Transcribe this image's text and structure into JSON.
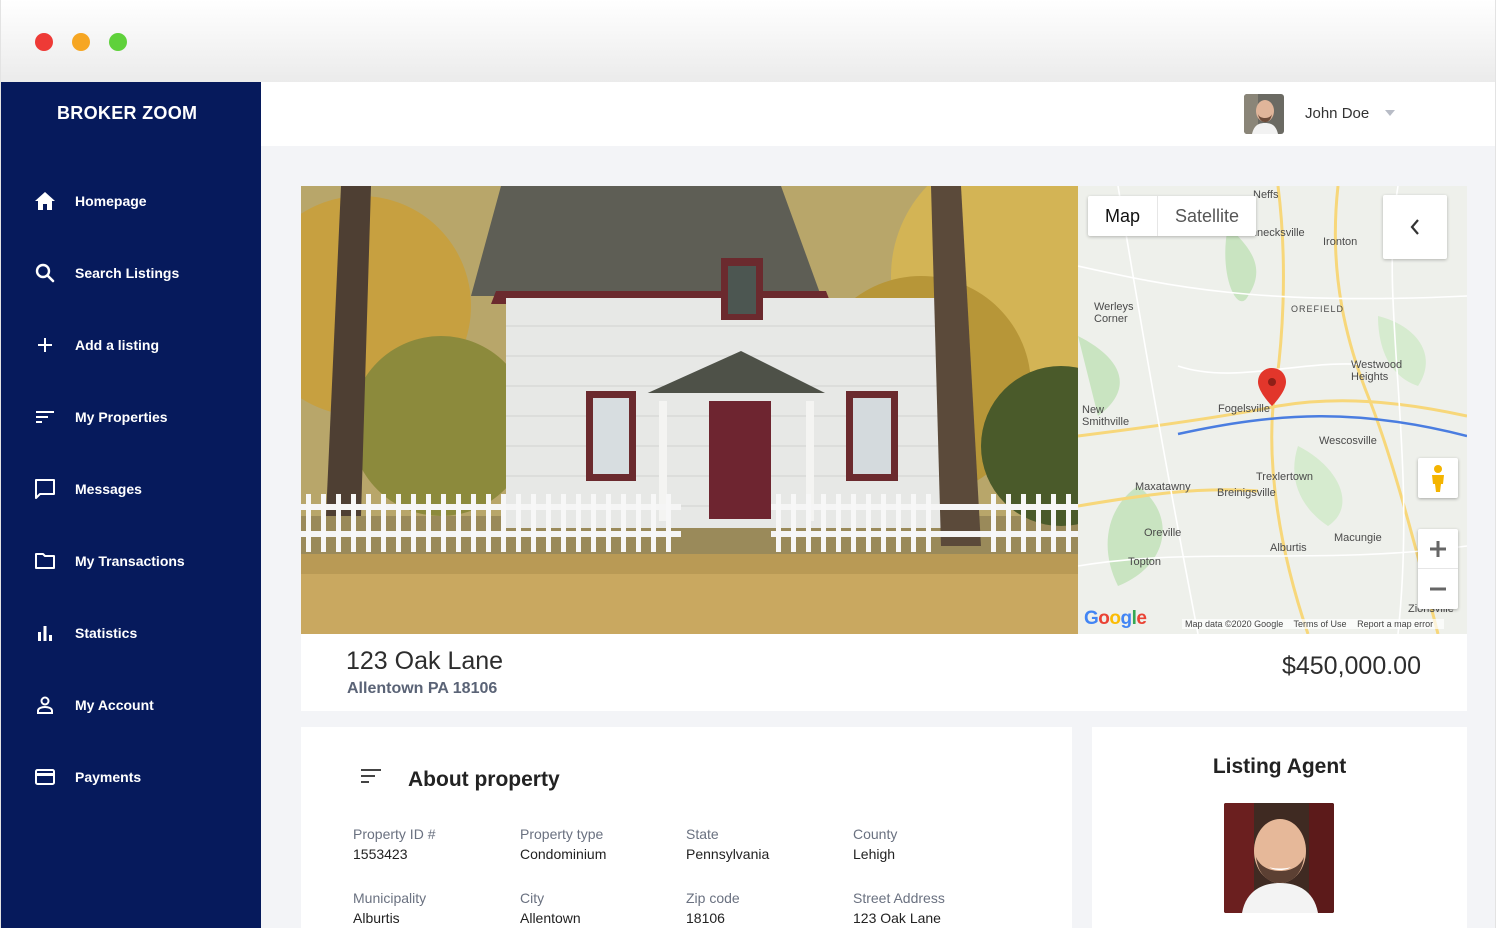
{
  "brand": {
    "logo_text": "BROKER ZOOM"
  },
  "sidebar": {
    "items": [
      {
        "label": "Homepage",
        "icon": "home-icon"
      },
      {
        "label": "Search Listings",
        "icon": "search-icon"
      },
      {
        "label": "Add a listing",
        "icon": "plus-icon"
      },
      {
        "label": "My Properties",
        "icon": "sort-lines-icon"
      },
      {
        "label": "Messages",
        "icon": "message-icon"
      },
      {
        "label": "My Transactions",
        "icon": "folder-icon"
      },
      {
        "label": "Statistics",
        "icon": "bar-chart-icon"
      },
      {
        "label": "My Account",
        "icon": "person-icon"
      },
      {
        "label": "Payments",
        "icon": "credit-card-icon"
      }
    ]
  },
  "user": {
    "name": "John Doe"
  },
  "map": {
    "tab_map": "Map",
    "tab_satellite": "Satellite",
    "footer_data": "Map data ©2020 Google",
    "footer_terms": "Terms of Use",
    "footer_report": "Report a map error",
    "logo": "Google",
    "places": [
      "Neffs",
      "Schnecksville",
      "Ironton",
      "OREFIELD",
      "Werleys Corner",
      "Westwood Heights",
      "New Smithville",
      "Fogelsville",
      "Wescosville",
      "Trexlertown",
      "Maxatawny",
      "Breinigsville",
      "Oreville",
      "Alburtis",
      "Macungie",
      "Topton",
      "Zionsville"
    ]
  },
  "property": {
    "address": "123 Oak Lane",
    "city_line": "Allentown PA 18106",
    "price": "$450,000.00"
  },
  "about": {
    "title": "About property",
    "fields": [
      {
        "label": "Property ID #",
        "value": "1553423"
      },
      {
        "label": "Property type",
        "value": "Condominium"
      },
      {
        "label": "State",
        "value": "Pennsylvania"
      },
      {
        "label": "County",
        "value": "Lehigh"
      },
      {
        "label": "Municipality",
        "value": "Alburtis"
      },
      {
        "label": "City",
        "value": "Allentown"
      },
      {
        "label": "Zip code",
        "value": "18106"
      },
      {
        "label": "Street Address",
        "value": "123 Oak Lane"
      }
    ]
  },
  "agent": {
    "title": "Listing Agent"
  },
  "colors": {
    "sidebar": "#061a5c",
    "accent": "#2d2d2d",
    "background": "#f3f4f7"
  }
}
